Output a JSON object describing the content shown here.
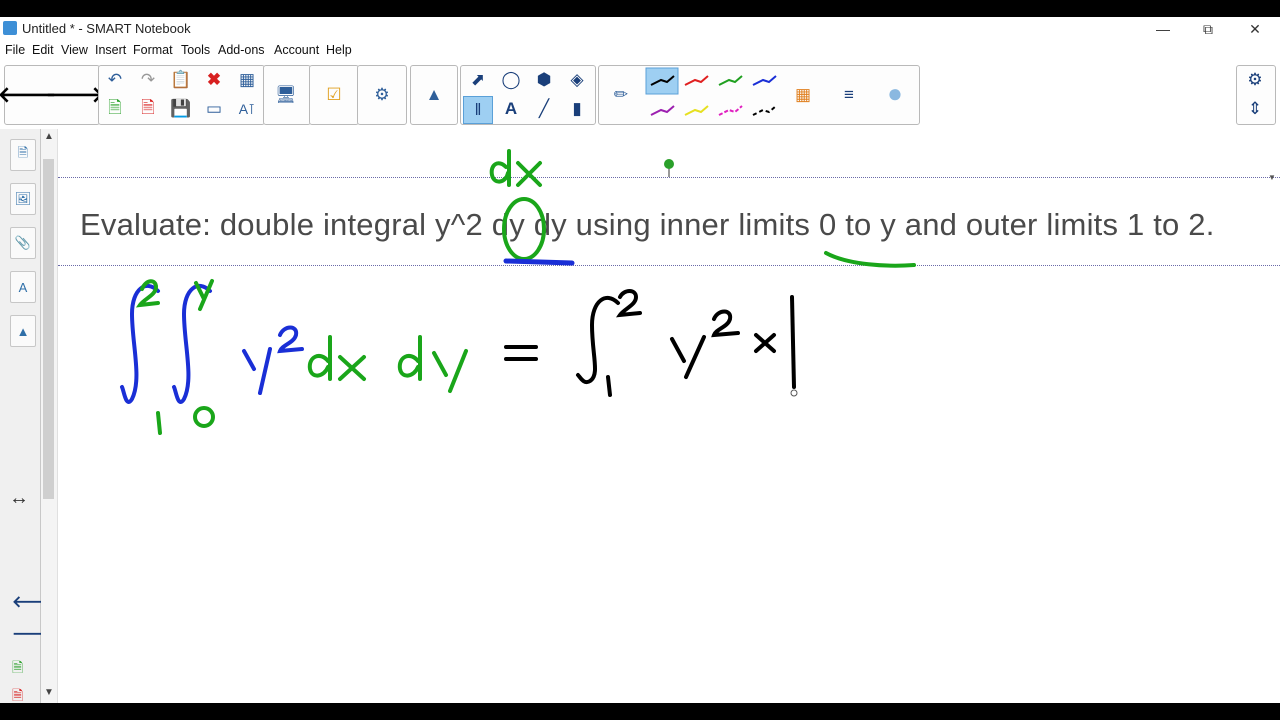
{
  "window": {
    "title": "Untitled * - SMART Notebook"
  },
  "menu": [
    "File",
    "Edit",
    "View",
    "Insert",
    "Format",
    "Tools",
    "Add-ons",
    "Account",
    "Help"
  ],
  "question": "Evaluate: double integral y^2 dy dy using inner limits 0 to y and outer limits 1 to 2.",
  "handwriting": {
    "note_above": "dx",
    "lhs": "∫₁²∫₀ʸ y² dx dy",
    "rhs": "= ∫₁² y² x |"
  },
  "colors": {
    "pen_green": "#1aa61a",
    "pen_blue": "#1a2fd6",
    "pen_black": "#000000",
    "accent": "#9ecff2"
  },
  "icons": [
    "back-arrow-icon",
    "forward-arrow-icon",
    "undo-icon",
    "redo-icon",
    "paste-icon",
    "delete-icon",
    "table-icon",
    "add-page-icon",
    "delete-page-icon",
    "save-icon",
    "screen-shade-icon",
    "properties-icon",
    "document-camera-icon",
    "response-icon",
    "addon-icon",
    "puzzle-icon",
    "select-icon",
    "shapes-icon",
    "regular-polygon-icon",
    "fill-icon",
    "measurement-icon",
    "text-icon",
    "line-icon",
    "eraser-icon",
    "pen-icon",
    "color-palette-icon",
    "line-style-icon",
    "transparency-icon",
    "settings-gear-icon",
    "toolbar-move-icon"
  ]
}
